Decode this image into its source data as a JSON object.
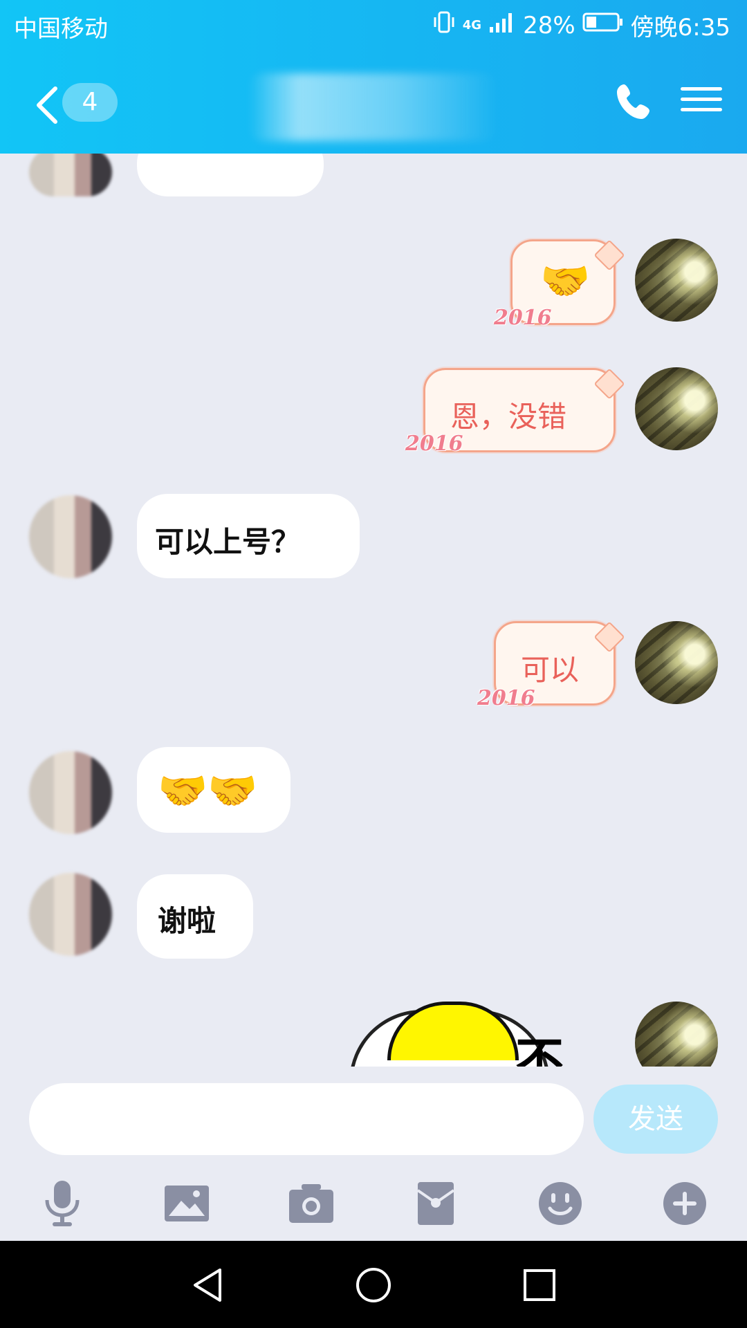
{
  "status_bar": {
    "carrier": "中国移动",
    "network": "4G",
    "battery": "28%",
    "time": "傍晚6:35"
  },
  "header": {
    "unread_count": "4",
    "call_icon": "phone-icon",
    "menu_icon": "menu-icon"
  },
  "messages": [
    {
      "from": "other",
      "text": "",
      "note": "partially cut off at top"
    },
    {
      "from": "me",
      "text": "🤝",
      "badge": "2016"
    },
    {
      "from": "me",
      "text": "恩，没错",
      "badge": "2016"
    },
    {
      "from": "other",
      "text": "可以上号？"
    },
    {
      "from": "me",
      "text": "可以",
      "badge": "2016"
    },
    {
      "from": "other",
      "text": "🤝🤝"
    },
    {
      "from": "other",
      "text": "谢啦"
    },
    {
      "from": "me",
      "text": "",
      "type": "sticker",
      "sticker_text": "不"
    }
  ],
  "input": {
    "value": "",
    "send_label": "发送"
  },
  "toolbar": [
    "mic-icon",
    "image-icon",
    "camera-icon",
    "red-packet-icon",
    "emoji-icon",
    "plus-icon"
  ],
  "colors": {
    "header": "#12c5f6",
    "chat_bg": "#e9ebf3",
    "my_bubble_text": "#e9615a",
    "send_button": "#b7e8fb"
  }
}
